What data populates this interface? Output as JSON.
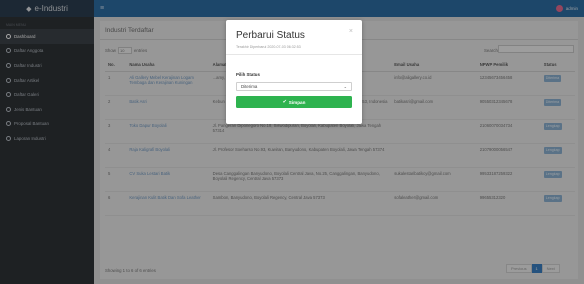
{
  "brand": {
    "name": "e-Industri"
  },
  "sidebar": {
    "section": "MAIN MENU",
    "items": [
      {
        "label": "Dashboard",
        "active": true
      },
      {
        "label": "Daftar Anggota"
      },
      {
        "label": "Daftar Industri"
      },
      {
        "label": "Daftar Artikel"
      },
      {
        "label": "Daftar Galeri"
      },
      {
        "label": "Jenis Bantuan"
      },
      {
        "label": "Proposal Bantuan"
      },
      {
        "label": "Laporan Industri"
      }
    ]
  },
  "topbar": {
    "username": "admin"
  },
  "page": {
    "title": "Industri Terdaftar",
    "show_label": "Show",
    "entries_value": "10",
    "entries_label": "entries",
    "search_label": "Search:",
    "columns": [
      "No.",
      "Nama Usaha",
      "Alamat",
      "Email Usaha",
      "NPWP Pemilik",
      "Status"
    ],
    "rows": [
      {
        "no": "1",
        "nama": "Ali Gallery Mebel Kerajinan Logam Tembaga dan Kerajinan Kuningan",
        "alamat": "...amy, Boyolali,",
        "email": "info@aligallery.co.id",
        "npwp": "12345673456458",
        "status": "Diterima"
      },
      {
        "no": "2",
        "nama": "Batik Asri",
        "alamat": "Kebun perdagaran, Sambon, Banyudono, Kabupaten Boyolali, Jawa Tengah 57353, Indonesia",
        "email": "batikasri@gmail.com",
        "npwp": "90550312345678",
        "status": "Diterima"
      },
      {
        "no": "3",
        "nama": "Toko Dapur Boyolali",
        "alamat": "Jl. Pangeran Diponegoro No.18, Siswodipuran, Boyolali, Kabupaten Boyolali, Jawa Tengah 57314",
        "email": "",
        "npwp": "21060070034734",
        "status": "Lengkap"
      },
      {
        "no": "4",
        "nama": "Raja Kaligrafi Boyolali",
        "alamat": "Jl. Profesor Soeharso No.93, Kuwiran, Banyudono, Kabupaten Boyolali, Jawa Tengah 57374",
        "email": "",
        "npwp": "21079000056547",
        "status": "Lengkap"
      },
      {
        "no": "5",
        "nama": "CV Suka Lestari Batik",
        "alamat": "Desa Canggalingan Banyudono, Boyolali Central Java, No.25, Canggalingan, Banyudono, Boyolali Regency, Central Java 57373",
        "email": "sukalestaribatikcy@gmail.com",
        "npwp": "99533187259322",
        "status": "Lengkap"
      },
      {
        "no": "6",
        "nama": "Kerajinan Kulit Batik Dan Sofa Leather",
        "alamat": "Sambon, Banyudono, Boyolali Regency, Central Java 57373",
        "email": "sofaleather@gmail.com",
        "npwp": "99655312320",
        "status": "Lengkap"
      }
    ],
    "showing": "Showing 1 to 6 of 6 entries",
    "pager": {
      "prev": "Previous",
      "current": "1",
      "next": "Next"
    }
  },
  "modal": {
    "title": "Perbarui Status",
    "subtitle": "Terakhir Diperbarui 2020-07-03 06:32:53",
    "close": "×",
    "field_label": "Pilih Status",
    "selected": "Diterima",
    "submit": "Simpan"
  }
}
